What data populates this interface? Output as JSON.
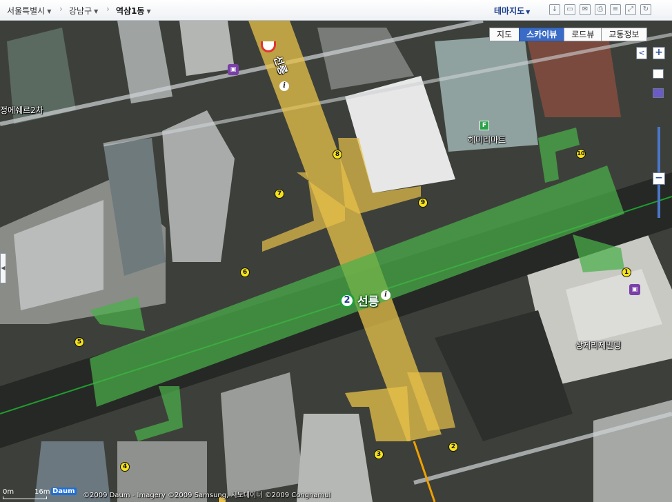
{
  "breadcrumb": {
    "city": "서울특별시",
    "district": "강남구",
    "dong": "역삼1동"
  },
  "theme_map_label": "테마지도",
  "toolbar_icons": [
    "download-icon",
    "save-icon",
    "mail-icon",
    "print-icon",
    "ruler-icon",
    "fullscreen-icon",
    "refresh-icon"
  ],
  "map_tabs": [
    {
      "label": "지도",
      "active": false
    },
    {
      "label": "스카이뷰",
      "active": true
    },
    {
      "label": "로드뷰",
      "active": false
    },
    {
      "label": "교통정보",
      "active": false
    }
  ],
  "zoom": {
    "plus": "+",
    "minus": "−",
    "left": "<"
  },
  "station": {
    "line": "2",
    "name": "선릉"
  },
  "top_station_name": "선릉",
  "labels": {
    "building_left": "정에쉐르2차",
    "mart": "헤미리마트",
    "building_right": "상제리제빌딩"
  },
  "exits": [
    "1",
    "2",
    "3",
    "4",
    "5",
    "6",
    "7",
    "8",
    "9",
    "10"
  ],
  "scale": {
    "zero": "0m",
    "end": "16m"
  },
  "logo": "Daum",
  "copyright": "©2009 Daum - Imagery ©2009 Samsung, 지도데이터 ©2009 Congnamul",
  "colors": {
    "yellow_overlay": "#e8c14a",
    "green_overlay": "#49b04a",
    "active_tab": "#3a6cc7"
  }
}
